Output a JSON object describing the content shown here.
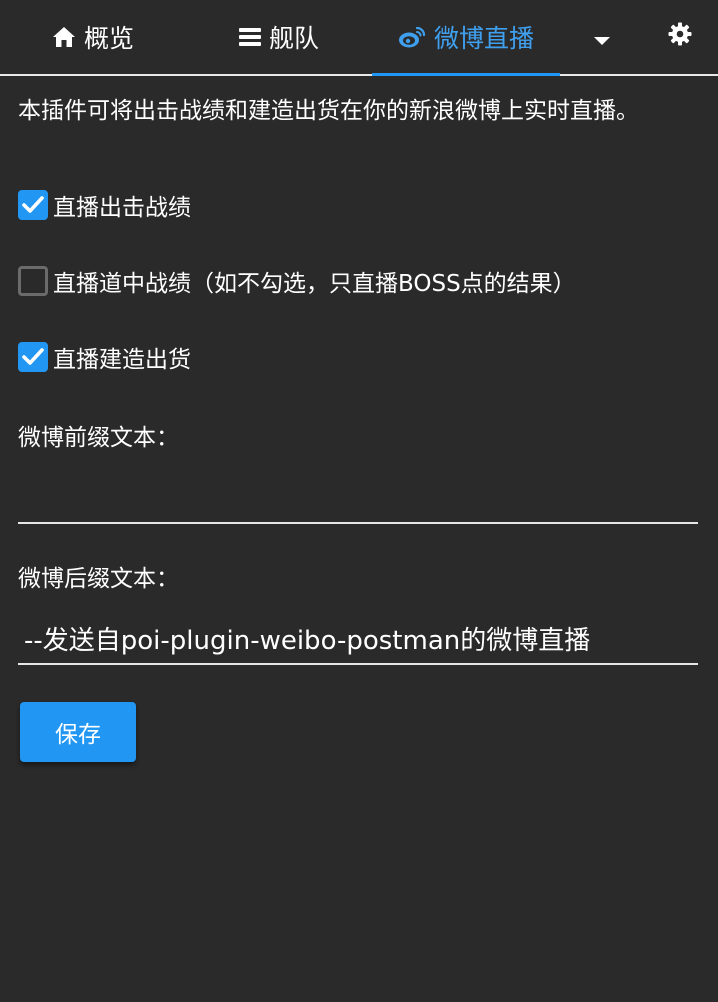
{
  "nav": {
    "tabs": [
      {
        "label": "概览",
        "icon": "home-icon"
      },
      {
        "label": "舰队",
        "icon": "bars-icon"
      },
      {
        "label": "微博直播",
        "icon": "weibo-icon",
        "active": true
      }
    ],
    "more_icon": "caret-down-icon",
    "settings_icon": "gear-icon"
  },
  "main": {
    "description": "本插件可将出击战绩和建造出货在你的新浪微博上实时直播。",
    "options": [
      {
        "label": "直播出击战绩",
        "checked": true
      },
      {
        "label": "直播道中战绩（如不勾选，只直播BOSS点的结果）",
        "checked": false
      },
      {
        "label": "直播建造出货",
        "checked": true
      }
    ],
    "prefix": {
      "label": "微博前缀文本：",
      "value": ""
    },
    "suffix": {
      "label": "微博后缀文本：",
      "value": "--发送自poi-plugin-weibo-postman的微博直播"
    },
    "save_label": "保存"
  },
  "colors": {
    "background": "#2a2a2a",
    "accent": "#2196f3",
    "active_tab_text": "#3fa0f0",
    "text": "#ffffff"
  }
}
